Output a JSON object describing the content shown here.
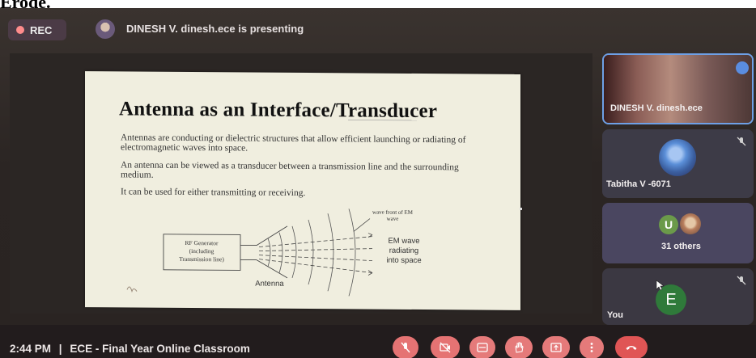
{
  "caption": "Erode.",
  "meeting": {
    "rec_label": "REC",
    "presenting_text": "DINESH V. dinesh.ece is presenting",
    "time": "2:44 PM",
    "separator": "|",
    "title": "ECE - Final Year Online Classroom"
  },
  "slide": {
    "title": "Antenna as an Interface/Transducer",
    "paragraphs": [
      "Antennas are conducting or dielectric structures that allow efficient launching or radiating of electromagnetic waves into space.",
      "An antenna can be viewed as a transducer between a transmission line and the surrounding medium.",
      "It can be used for either transmitting or receiving."
    ],
    "diagram": {
      "generator_label_1": "RF Generator",
      "generator_label_2": "(including",
      "generator_label_3": "Transmission line)",
      "antenna_label": "Antenna",
      "wavefront_label_1": "wave front of EM",
      "wavefront_label_2": "wave",
      "em_label_1": "EM wave",
      "em_label_2": "radiating",
      "em_label_3": "into space"
    }
  },
  "participants": [
    {
      "name": "DINESH V. dinesh.ece",
      "muted": false,
      "speaking": true
    },
    {
      "name": "Tabitha V -6071",
      "muted": true
    },
    {
      "name": "31 others",
      "avatar_letter": "U"
    },
    {
      "name": "You",
      "avatar_letter": "E",
      "muted": true
    }
  ],
  "colors": {
    "background": "#2b2523",
    "control_red": "#e57373",
    "speaking_blue": "#5a8de0",
    "presenter_border": "#6ea0e6"
  },
  "icons": [
    "mic-off-icon",
    "camera-off-icon",
    "captions-icon",
    "raise-hand-icon",
    "present-icon",
    "more-options-icon",
    "hang-up-icon"
  ]
}
